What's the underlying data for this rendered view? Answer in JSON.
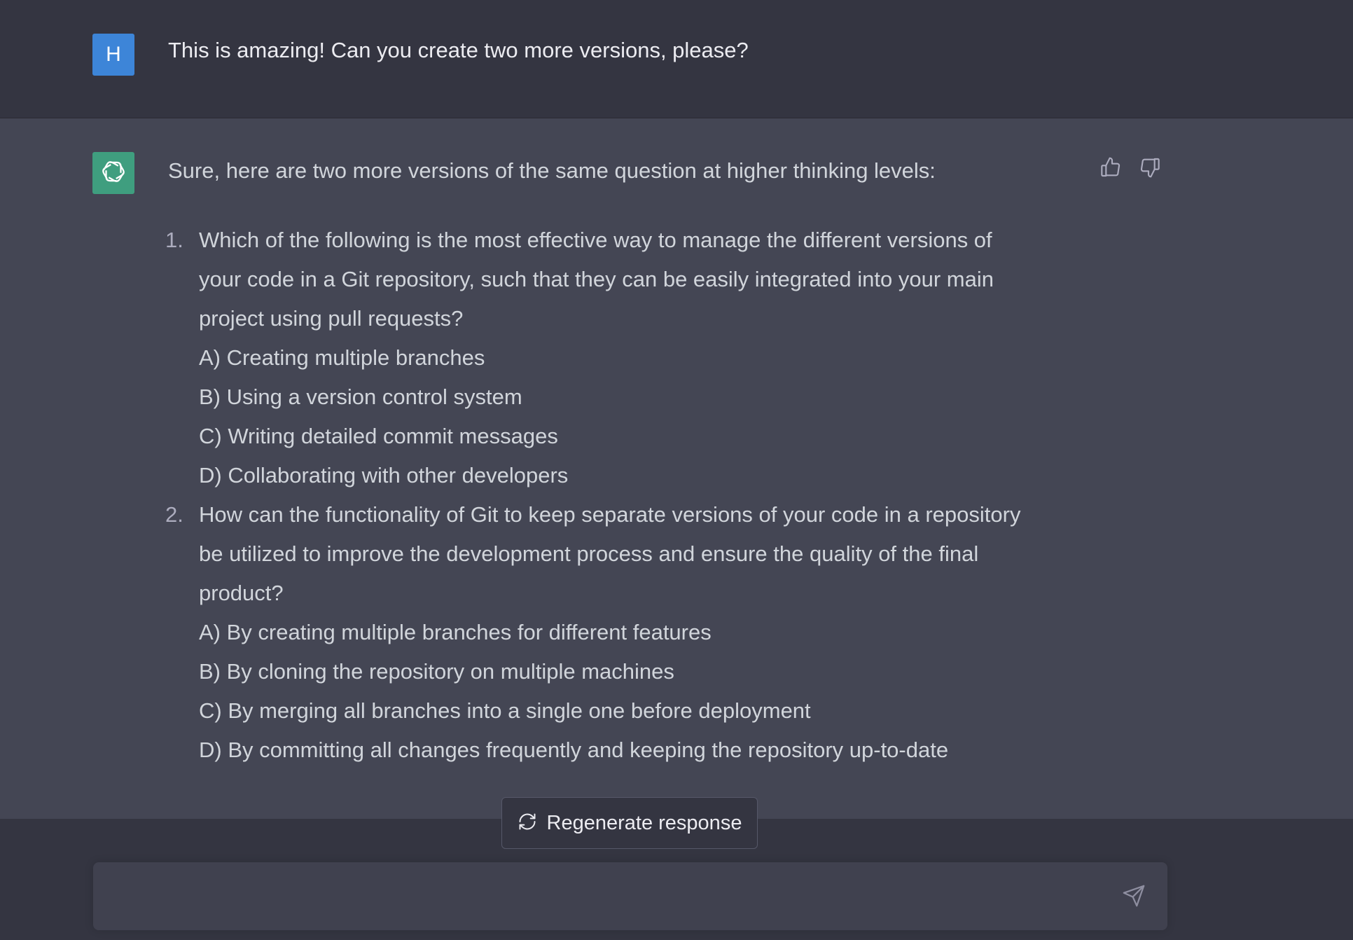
{
  "user_message": {
    "avatar_letter": "H",
    "avatar_color": "#3d85d8",
    "text": "This is amazing! Can you create two more versions, please?"
  },
  "assistant_message": {
    "avatar_icon": "openai-logo-icon",
    "avatar_color": "#3f9e7f",
    "intro": "Sure, here are two more versions of the same question at higher thinking levels:",
    "questions": [
      {
        "number": "1.",
        "lines": [
          "Which of the following is the most effective way to manage the different versions of",
          "your code in a Git repository, such that they can be easily integrated into your main",
          "project using pull requests?"
        ],
        "options": [
          "A) Creating multiple branches",
          "B) Using a version control system",
          "C) Writing detailed commit messages",
          "D) Collaborating with other developers"
        ]
      },
      {
        "number": "2.",
        "lines": [
          "How can the functionality of Git to keep separate versions of your code in a repository",
          "be utilized to improve the development process and ensure the quality of the final",
          "product?"
        ],
        "options": [
          "A) By creating multiple branches for different features",
          "B) By cloning the repository on multiple machines",
          "C) By merging all branches into a single one before deployment",
          "D) By committing all changes frequently and keeping the repository up-to-date"
        ]
      }
    ],
    "feedback_icons": [
      "thumbs-up-icon",
      "thumbs-down-icon"
    ]
  },
  "regenerate": {
    "label": "Regenerate response",
    "icon": "refresh-icon"
  },
  "composer": {
    "value": "",
    "send_icon": "send-icon"
  },
  "colors": {
    "page_bg": "#343541",
    "assistant_bg": "#444654",
    "input_bg": "#40414f",
    "text": "#d1d5db"
  }
}
